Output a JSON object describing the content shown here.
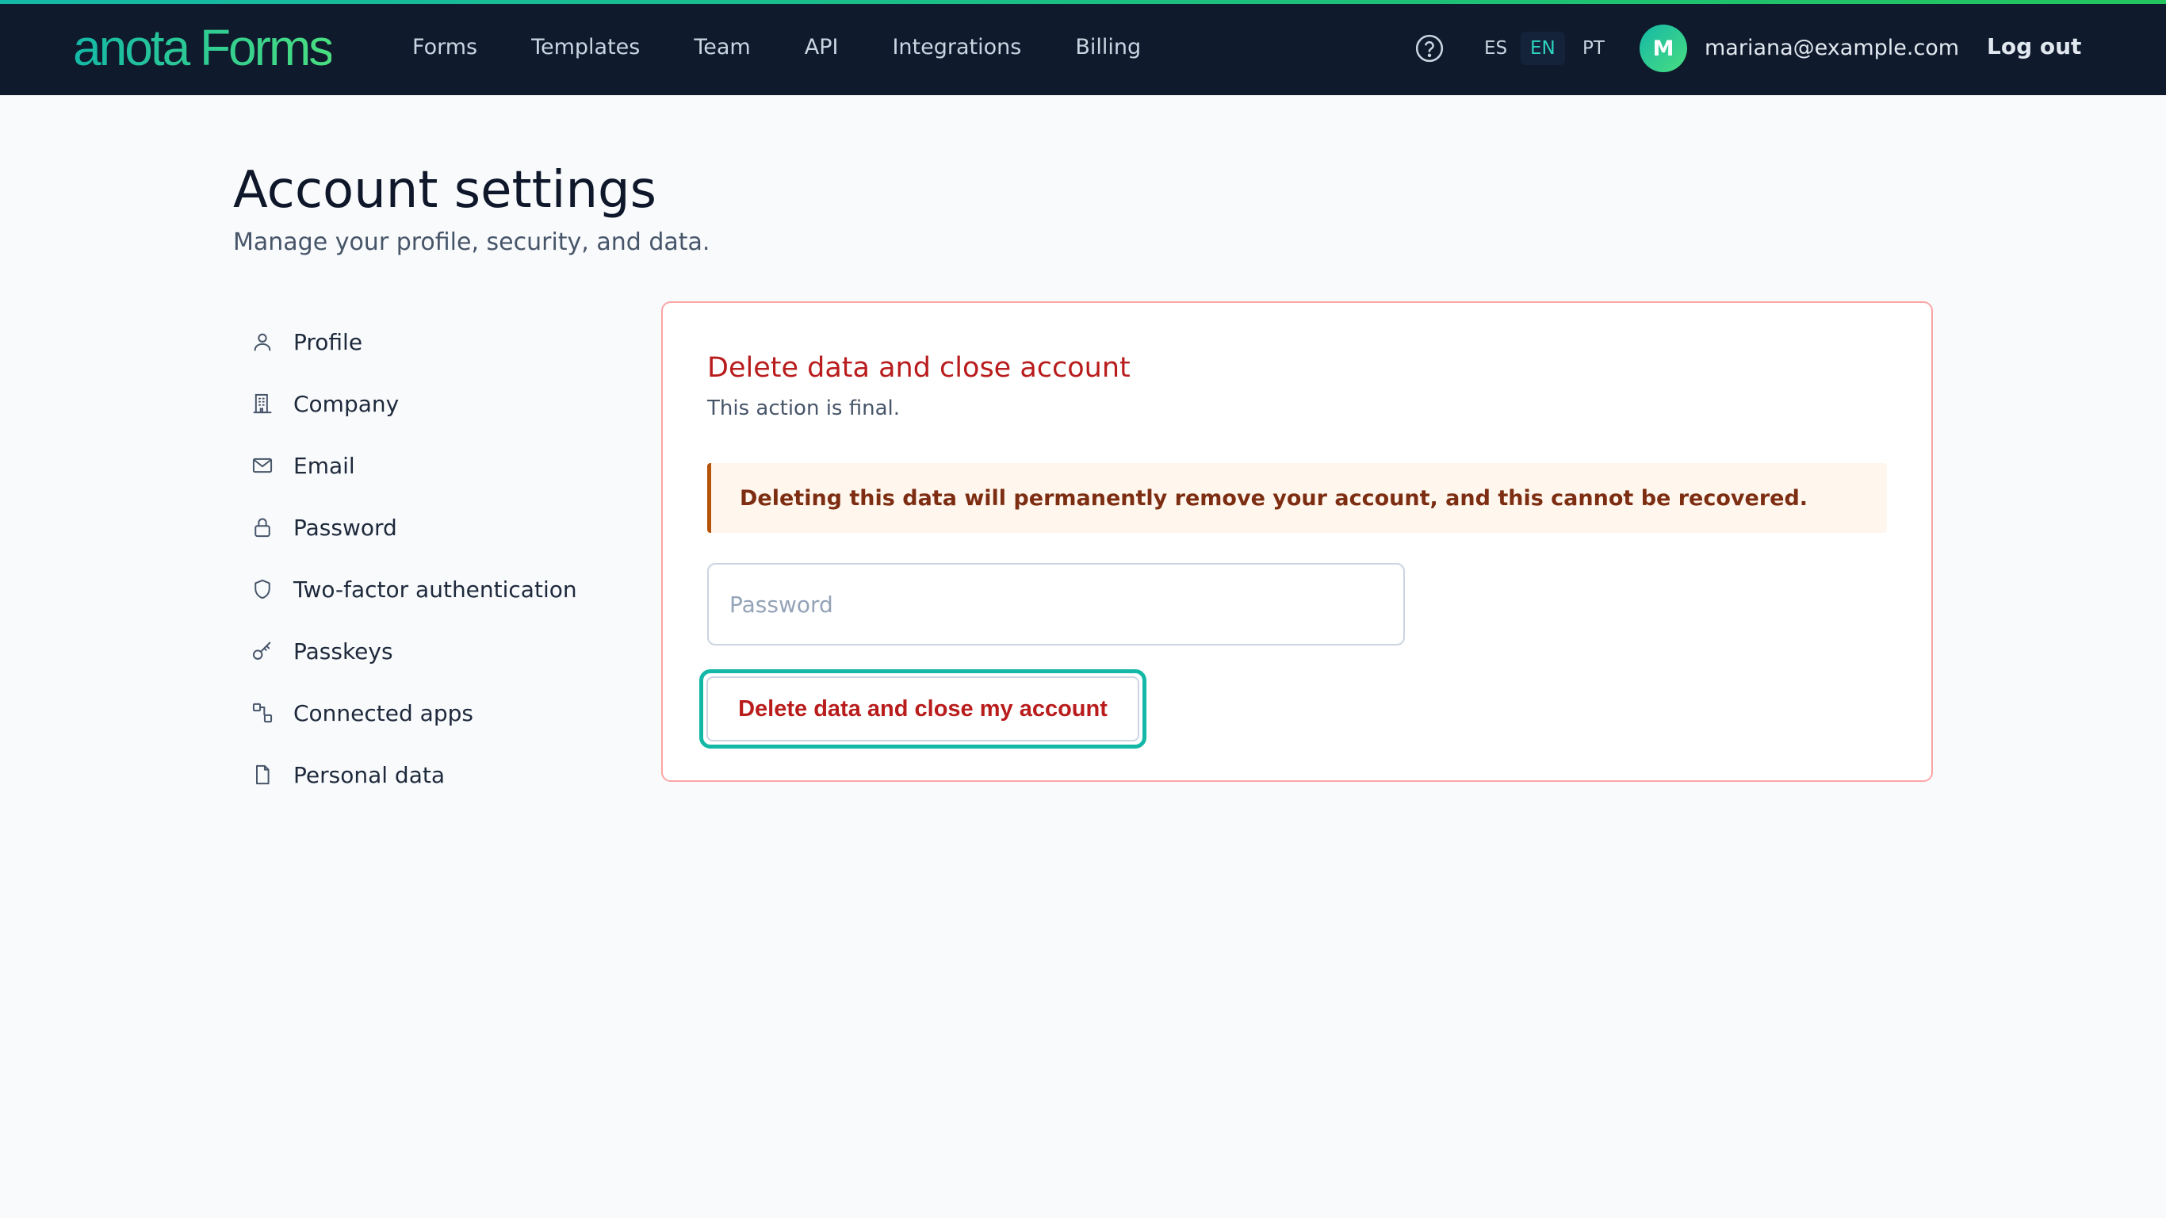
{
  "app": {
    "logo_text": "anota Forms"
  },
  "nav": {
    "items": [
      "Forms",
      "Templates",
      "Team",
      "API",
      "Integrations",
      "Billing"
    ]
  },
  "header": {
    "help_icon": "help-circle-icon",
    "languages": [
      {
        "code": "ES",
        "active": false
      },
      {
        "code": "EN",
        "active": true
      },
      {
        "code": "PT",
        "active": false
      }
    ],
    "user": {
      "initial": "M",
      "email": "mariana@example.com"
    },
    "logout_label": "Log out"
  },
  "page": {
    "title": "Account settings",
    "subtitle": "Manage your profile, security, and data."
  },
  "sidebar": {
    "items": [
      {
        "label": "Profile",
        "icon": "user-icon"
      },
      {
        "label": "Company",
        "icon": "building-icon"
      },
      {
        "label": "Email",
        "icon": "mail-icon"
      },
      {
        "label": "Password",
        "icon": "lock-icon"
      },
      {
        "label": "Two-factor authentication",
        "icon": "shield-icon"
      },
      {
        "label": "Passkeys",
        "icon": "key-icon"
      },
      {
        "label": "Connected apps",
        "icon": "link-icon"
      },
      {
        "label": "Personal data",
        "icon": "file-icon"
      }
    ]
  },
  "danger": {
    "title": "Delete data and close account",
    "description": "This action is final.",
    "warning": "Deleting this data will permanently remove your account, and this cannot be recovered.",
    "password_placeholder": "Password",
    "password_value": "",
    "button_label": "Delete data and close my account"
  },
  "colors": {
    "topbar": "#0f1b2d",
    "accent": "#14b8a6",
    "danger": "#b91c1c",
    "warning_bg": "#fff7ed",
    "warning_border": "#b45309"
  }
}
